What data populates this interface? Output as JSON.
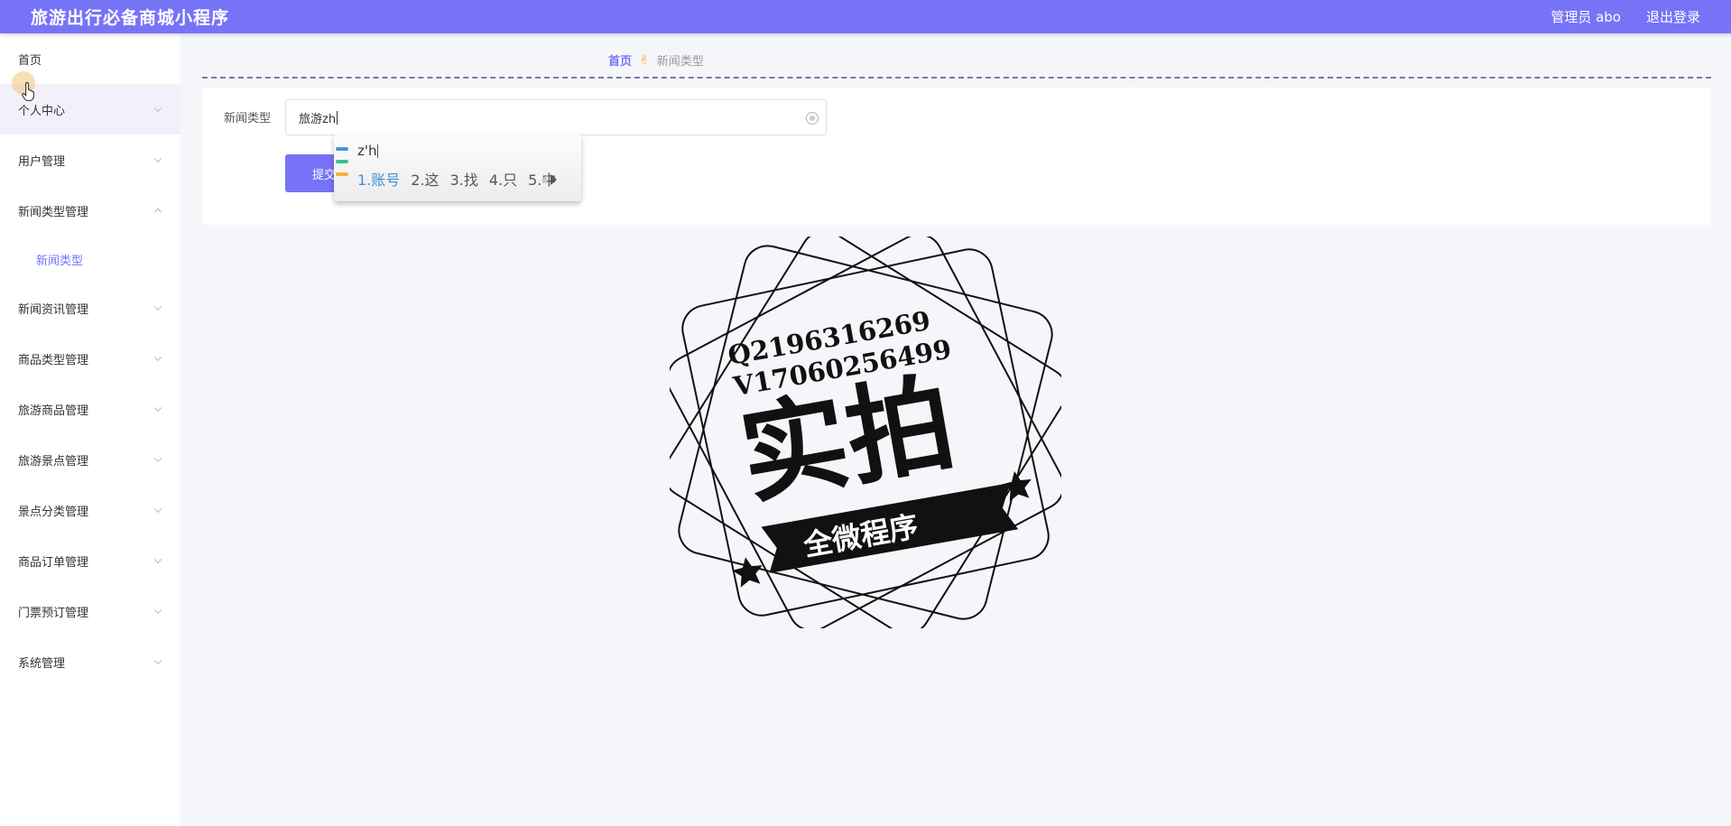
{
  "header": {
    "title": "旅游出行必备商城小程序",
    "user_label": "管理员 abo",
    "logout_label": "退出登录"
  },
  "sidebar": {
    "items": [
      {
        "label": "首页"
      },
      {
        "label": "个人中心"
      },
      {
        "label": "用户管理"
      },
      {
        "label": "新闻类型管理",
        "expanded": true,
        "children": [
          {
            "label": "新闻类型"
          }
        ]
      },
      {
        "label": "新闻资讯管理"
      },
      {
        "label": "商品类型管理"
      },
      {
        "label": "旅游商品管理"
      },
      {
        "label": "旅游景点管理"
      },
      {
        "label": "景点分类管理"
      },
      {
        "label": "商品订单管理"
      },
      {
        "label": "门票预订管理"
      },
      {
        "label": "系统管理"
      }
    ]
  },
  "breadcrumb": {
    "home": "首页",
    "current": "新闻类型"
  },
  "form": {
    "field_label": "新闻类型",
    "field_value": "旅游zh",
    "submit_label": "提交"
  },
  "ime": {
    "composition": "z'h",
    "candidates": [
      "1.账号",
      "2.这",
      "3.找",
      "4.只",
      "5.中"
    ]
  },
  "watermark": {
    "line1": "Q2196316269",
    "line2": "V17060256499",
    "main": "实拍",
    "banner": "全微程序"
  },
  "colors": {
    "accent": "#7773f7",
    "ime_highlight": "#3f8fd6"
  },
  "icons": {
    "dropdown": "chevron-down-icon",
    "expanded": "chevron-up-icon",
    "clear": "clear-icon",
    "cursor": "hand-pointer-icon"
  }
}
